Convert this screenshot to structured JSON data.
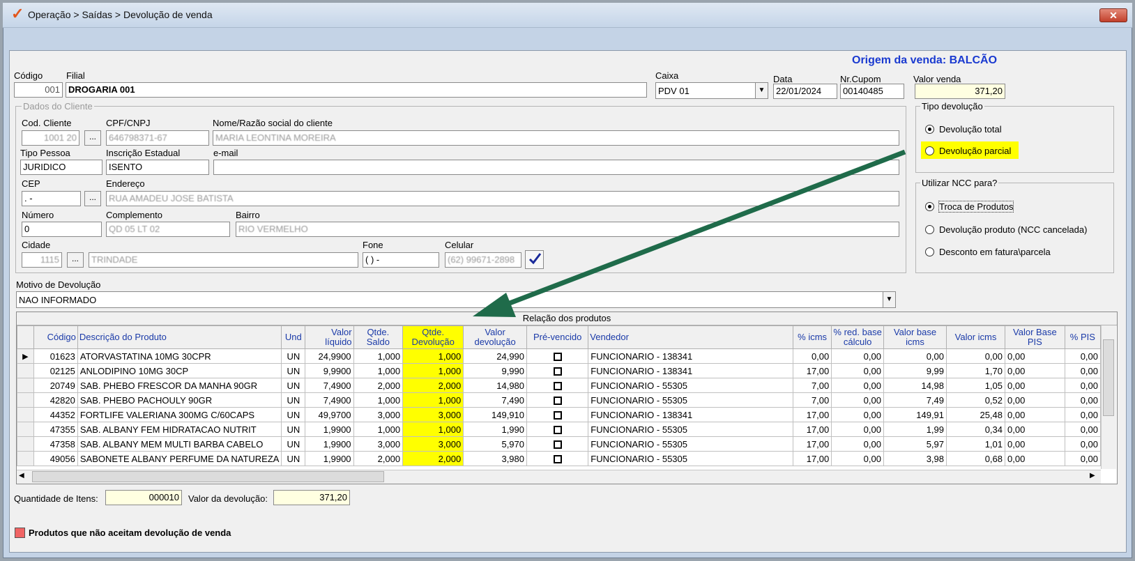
{
  "window": {
    "title": "Operação > Saídas > Devolução de venda",
    "close_label": "✕"
  },
  "header": {
    "origin": "Origem da venda: BALCÃO",
    "codigo_label": "Código",
    "codigo": "001",
    "filial_label": "Filial",
    "filial": "DROGARIA 001",
    "caixa_label": "Caixa",
    "caixa": "PDV 01",
    "data_label": "Data",
    "data": "22/01/2024",
    "cupom_label": "Nr.Cupom",
    "cupom": "00140485",
    "valor_venda_label": "Valor venda",
    "valor_venda": "371,20"
  },
  "cliente": {
    "group_label": "Dados do Cliente",
    "cod_label": "Cod. Cliente",
    "cod": "1001 20",
    "cpf_label": "CPF/CNPJ",
    "cpf": "646798371-67",
    "nome_label": "Nome/Razão social do cliente",
    "nome": "MARIA LEONTINA MOREIRA",
    "tipo_label": "Tipo Pessoa",
    "tipo": "JURIDICO",
    "ie_label": "Inscrição Estadual",
    "ie": "ISENTO",
    "email_label": "e-mail",
    "email": "",
    "cep_label": "CEP",
    "cep": " .   -",
    "endereco_label": "Endereço",
    "endereco": "RUA AMADEU JOSE BATISTA",
    "numero_label": "Número",
    "numero": "0",
    "complemento_label": "Complemento",
    "complemento": "QD 05 LT 02",
    "bairro_label": "Bairro",
    "bairro": "RIO VERMELHO",
    "cidade_label": "Cidade",
    "cidade_cod": "1115",
    "cidade": "TRINDADE",
    "fone_label": "Fone",
    "fone": "( )    -",
    "celular_label": "Celular",
    "celular": "(62) 99671-2898",
    "dots": "..."
  },
  "tipo_devolucao": {
    "label": "Tipo devolução",
    "options": [
      "Devolução total",
      "Devolução parcial"
    ],
    "selected": 0
  },
  "ncc": {
    "label": "Utilizar NCC para?",
    "options": [
      "Troca de Produtos",
      "Devolução produto (NCC cancelada)",
      "Desconto em fatura\\parcela"
    ],
    "selected": 0
  },
  "motivo": {
    "label": "Motivo de Devolução",
    "value": "NAO INFORMADO"
  },
  "grid": {
    "title": "Relação dos produtos",
    "columns": [
      "Código",
      "Descrição do Produto",
      "Und",
      "Valor líquido",
      "Qtde. Saldo",
      "Qtde. Devolução",
      "Valor devolução",
      "Pré-vencido",
      "Vendedor",
      "% icms",
      "% red. base cálculo",
      "Valor base icms",
      "Valor icms",
      "Valor Base PIS",
      "% PIS"
    ],
    "rows": [
      [
        "01623",
        "ATORVASTATINA 10MG 30CPR",
        "UN",
        "24,9900",
        "1,000",
        "1,000",
        "24,990",
        "",
        "FUNCIONARIO - 138341",
        "0,00",
        "0,00",
        "0,00",
        "0,00",
        "0,00",
        "0,00"
      ],
      [
        "02125",
        "ANLODIPINO 10MG  30CP",
        "UN",
        "9,9900",
        "1,000",
        "1,000",
        "9,990",
        "",
        "FUNCIONARIO - 138341",
        "17,00",
        "0,00",
        "9,99",
        "1,70",
        "0,00",
        "0,00"
      ],
      [
        "20749",
        "SAB. PHEBO FRESCOR DA MANHA 90GR",
        "UN",
        "7,4900",
        "2,000",
        "2,000",
        "14,980",
        "",
        "FUNCIONARIO - 55305",
        "7,00",
        "0,00",
        "14,98",
        "1,05",
        "0,00",
        "0,00"
      ],
      [
        "42820",
        "SAB. PHEBO PACHOULY 90GR",
        "UN",
        "7,4900",
        "1,000",
        "1,000",
        "7,490",
        "",
        "FUNCIONARIO - 55305",
        "7,00",
        "0,00",
        "7,49",
        "0,52",
        "0,00",
        "0,00"
      ],
      [
        "44352",
        "FORTLIFE VALERIANA  300MG C/60CAPS",
        "UN",
        "49,9700",
        "3,000",
        "3,000",
        "149,910",
        "",
        "FUNCIONARIO - 138341",
        "17,00",
        "0,00",
        "149,91",
        "25,48",
        "0,00",
        "0,00"
      ],
      [
        "47355",
        "SAB. ALBANY FEM HIDRATACAO NUTRIT",
        "UN",
        "1,9900",
        "1,000",
        "1,000",
        "1,990",
        "",
        "FUNCIONARIO - 55305",
        "17,00",
        "0,00",
        "1,99",
        "0,34",
        "0,00",
        "0,00"
      ],
      [
        "47358",
        "SAB. ALBANY MEM MULTI BARBA CABELO",
        "UN",
        "1,9900",
        "3,000",
        "3,000",
        "5,970",
        "",
        "FUNCIONARIO - 55305",
        "17,00",
        "0,00",
        "5,97",
        "1,01",
        "0,00",
        "0,00"
      ],
      [
        "49056",
        "SABONETE ALBANY PERFUME DA NATUREZA",
        "UN",
        "1,9900",
        "2,000",
        "2,000",
        "3,980",
        "",
        "FUNCIONARIO - 55305",
        "17,00",
        "0,00",
        "3,98",
        "0,68",
        "0,00",
        "0,00"
      ]
    ]
  },
  "footer": {
    "qtd_label": "Quantidade de Itens:",
    "qtd": "000010",
    "valor_label": "Valor da devolução:",
    "valor": "371,20",
    "legend": "Produtos que não aceitam devolução de venda"
  },
  "colors": {
    "highlight": "#ffff00",
    "arrow": "#1f6b4a",
    "legend_swatch": "#f06464"
  }
}
